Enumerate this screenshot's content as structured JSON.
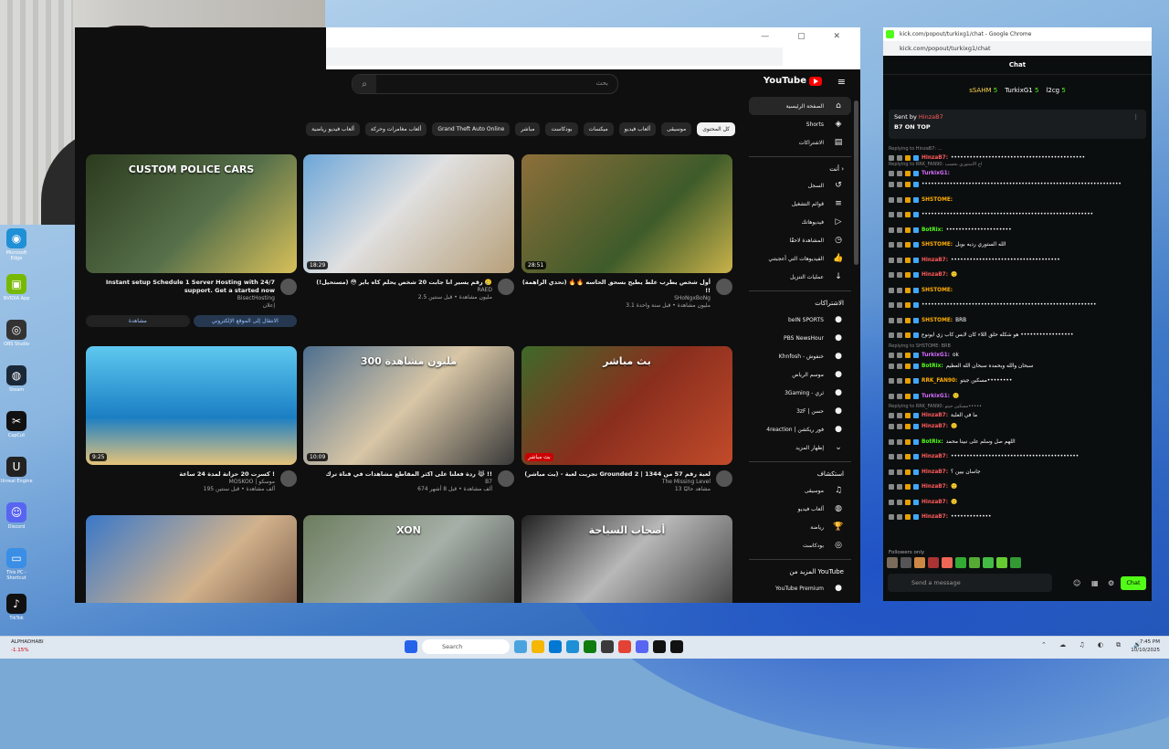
{
  "desktop": {
    "icons": [
      {
        "label": "Microsoft Edge",
        "color": "#1f8fd6",
        "glyph": "◉"
      },
      {
        "label": "NVIDIA App",
        "color": "#76b900",
        "glyph": "▣"
      },
      {
        "label": "OBS Studio",
        "color": "#333333",
        "glyph": "◎"
      },
      {
        "label": "Steam",
        "color": "#1b2838",
        "glyph": "◍"
      },
      {
        "label": "CapCut",
        "color": "#111111",
        "glyph": "✂"
      },
      {
        "label": "Unreal Engine",
        "color": "#222222",
        "glyph": "U"
      },
      {
        "label": "Discord",
        "color": "#5865f2",
        "glyph": "☺"
      },
      {
        "label": "This PC - Shortcut",
        "color": "#3a8ee6",
        "glyph": "▭"
      },
      {
        "label": "TikTok",
        "color": "#111111",
        "glyph": "♪"
      }
    ]
  },
  "youtube": {
    "search_placeholder": "بحث",
    "logo_text": "YouTube",
    "chips": [
      {
        "label": "كل المحتوى",
        "active": true
      },
      {
        "label": "موسيقى"
      },
      {
        "label": "ألعاب فيديو"
      },
      {
        "label": "ميكسات"
      },
      {
        "label": "بودكاست"
      },
      {
        "label": "مباشر"
      },
      {
        "label": "Grand Theft Auto Online"
      },
      {
        "label": "ألعاب مغامرات وحركة"
      },
      {
        "label": "ألعاب فيديو رياضية"
      }
    ],
    "videos": [
      {
        "title": "أول شخص يطرب علط يطيح بسحق الحاسه 🔥🔥 (تحدي الراهمة) !!",
        "channel": "SHoNgxBoNg",
        "meta": "3.1 مليون مشاهدة • قبل سنة واحدة",
        "duration": "28:51",
        "bg": "linear-gradient(135deg,#8d6f3a,#3e5b2a 60%,#c9b24a)"
      },
      {
        "title": "رقم يسير انا جابت 20 شخص يحلم كاه باير 😳 (مستحيل!) 🥲",
        "channel": "RAED",
        "meta": "2.5 مليون مشاهدة • قبل سنتين",
        "duration": "18:29",
        "bg": "linear-gradient(135deg,#6ca6d8,#e0e0e0 45%,#b7a07a)"
      },
      {
        "title": "Instant setup Schedule 1 Server Hosting with 24/7 support. Get a started now",
        "channel": "BisectHosting",
        "meta": "إعلان",
        "duration": "",
        "bg": "linear-gradient(135deg,#2b3b1e,#57704a 55%,#d7c05a)",
        "overlay": "CUSTOM POLICE CARS",
        "ad_buttons": [
          "مشاهدة",
          "الانتقال إلى الموقع الإلكتروني"
        ]
      },
      {
        "title": "(بث مباشر) - تجربت لعبة Grounded 2 | لعبة رقم 57 من 1344",
        "channel": "The Missing Level",
        "meta": "13 مشاهد حاليًا",
        "duration": "بث مباشر",
        "bg": "linear-gradient(135deg,#3e6a2a,#8a2e1e 50%,#c24b2a)",
        "overlay": "بث مباشر"
      },
      {
        "title": "ردة فعلنا على اكثر المقاطع مشاهدات في قناة ترك 😹 !!",
        "channel": "B7",
        "meta": "674 ألف مشاهدة • قبل 8 أشهر",
        "duration": "10:09",
        "bg": "linear-gradient(135deg,#4e6f8f,#d8c6a6 50%,#3a3a3a)",
        "overlay": "300 مليون مشاهدة"
      },
      {
        "title": "كسرت 20 حزانة لمدة 24 ساعة !",
        "channel": "MOSKOO | موسكو",
        "meta": "195 ألف مشاهدة • قبل سنتين",
        "duration": "9:25",
        "bg": "linear-gradient(180deg,#5ec8ef,#1b7fc4 60%,#e6c37a)"
      },
      {
        "title": "",
        "channel": "",
        "meta": "",
        "duration": "",
        "bg": "linear-gradient(135deg,#222,#b8b8b8 45%,#2e2e2e)",
        "overlay": "أصحاب السياحة"
      },
      {
        "title": "",
        "channel": "",
        "meta": "",
        "duration": "",
        "bg": "linear-gradient(135deg,#6c7d5e,#a6b0a8 50%,#3d3d3d)",
        "overlay": "XON"
      },
      {
        "title": "",
        "channel": "",
        "meta": "",
        "duration": "",
        "bg": "linear-gradient(135deg,#3a78c9,#d1b28c 55%,#6b4a3a)"
      }
    ],
    "sidebar": {
      "main": [
        {
          "label": "الصفحة الرئيسية",
          "icon": "⌂",
          "active": true
        },
        {
          "label": "Shorts",
          "icon": "◈"
        },
        {
          "label": "الاشتراكات",
          "icon": "▤"
        }
      ],
      "you_header": "أنت",
      "you": [
        {
          "label": "السجل",
          "icon": "↺"
        },
        {
          "label": "قوائم التشغيل",
          "icon": "≡"
        },
        {
          "label": "فيديوهاتك",
          "icon": "▷"
        },
        {
          "label": "المشاهدة لاحقًا",
          "icon": "◷"
        },
        {
          "label": "الفيديوهات التي أعجبتني",
          "icon": "👍"
        },
        {
          "label": "عمليات التنزيل",
          "icon": "↓"
        }
      ],
      "subs_header": "الاشتراكات",
      "subs": [
        {
          "label": "beIN SPORTS"
        },
        {
          "label": "PBS NewsHour"
        },
        {
          "label": "Khnfosh - خنفوش"
        },
        {
          "label": "موسم الرياض"
        },
        {
          "label": "3Gaming - ثري"
        },
        {
          "label": "3zF | حسن"
        },
        {
          "label": "4reaction | فور ريكشن"
        }
      ],
      "show_more": "إظهار المزيد",
      "explore_header": "استكشاف",
      "explore": [
        {
          "label": "موسيقى",
          "icon": "♫"
        },
        {
          "label": "ألعاب فيديو",
          "icon": "◍"
        },
        {
          "label": "رياضة",
          "icon": "🏆"
        },
        {
          "label": "بودكاست",
          "icon": "◎"
        }
      ],
      "more_header": "المزيد من YouTube",
      "more": [
        {
          "label": "YouTube Premium"
        }
      ]
    }
  },
  "kick": {
    "window_title": "kick.com/popout/turkixg1/chat - Google Chrome",
    "url": "kick.com/popout/turkixg1/chat",
    "header": "Chat",
    "top_gifters": [
      {
        "name": "sSAHM",
        "count": "5"
      },
      {
        "name": "TurkixG1",
        "count": "5"
      },
      {
        "name": "l2cg",
        "count": "5"
      }
    ],
    "pinned": {
      "sent_by": "Sent by",
      "user": "HinzaB7",
      "text": "B7 ON TOP"
    },
    "messages": [
      {
        "reply": "Replying to HinzaB7: ...",
        "user": "HinzaB7:",
        "color": "#ff5b5b",
        "text": "•••••••••••••••••••••••••••••••••••••••••••"
      },
      {
        "reply": "Replying to RRK_FAN90: اح الاستوري بحسب",
        "user": "TurkixG1:",
        "color": "#d66bff",
        "text": ""
      },
      {
        "user": "",
        "color": "#ffffff",
        "text": "••••••••••••••••••••••••••••••••••••••••••••••••••••••••••••••••"
      },
      {
        "user": "SHSTOME:",
        "color": "#ffae00",
        "text": ""
      },
      {
        "user": "",
        "color": "#ffffff",
        "text": "•••••••••••••••••••••••••••••••••••••••••••••••••••••••"
      },
      {
        "user": "BotRix:",
        "color": "#53fc18",
        "text": "•••••••••••••••••••••"
      },
      {
        "user": "SHSTOME:",
        "color": "#ffae00",
        "text": "الله الستوري رديه بوبل"
      },
      {
        "user": "HinzaB7:",
        "color": "#ff5b5b",
        "text": "•••••••••••••••••••••••••••••••••••"
      },
      {
        "user": "HinzaB7:",
        "color": "#ff5b5b",
        "text": "🙂"
      },
      {
        "user": "SHSTOME:",
        "color": "#ffae00",
        "text": ""
      },
      {
        "user": "",
        "color": "#ffffff",
        "text": "••••••••••••••••••••••••••••••••••••••••••••••••••••••••"
      },
      {
        "user": "SHSTOME:",
        "color": "#ffae00",
        "text": "BRB"
      },
      {
        "user": "",
        "color": "#ffffff",
        "text": "هو شكله حلق اللاء كان لابس كاب زي ايونوع •••••••••••••••••"
      },
      {
        "reply": "Replying to SHSTOME: BRB",
        "user": "TurkixG1:",
        "color": "#d66bff",
        "text": "ok"
      },
      {
        "user": "BotRix:",
        "color": "#53fc18",
        "text": "سبحان والله وبحمده سبحان الله العظيم"
      },
      {
        "user": "RRK_FAN90:",
        "color": "#ffae00",
        "text": "مسكين جيتو••••••••"
      },
      {
        "user": "TurkixG1:",
        "color": "#d66bff",
        "text": "🙂"
      },
      {
        "reply": "Replying to RRK_FAN90: مسكين جيتو•••••",
        "user": "HinzaB7:",
        "color": "#ff5b5b",
        "text": "ما في الغلبة"
      },
      {
        "user": "HinzaB7:",
        "color": "#ff5b5b",
        "text": "🙂"
      },
      {
        "user": "BotRix:",
        "color": "#53fc18",
        "text": "اللهم صل وسلم على نبينا محمد"
      },
      {
        "user": "HinzaB7:",
        "color": "#ff5b5b",
        "text": "•••••••••••••••••••••••••••••••••••••••••"
      },
      {
        "user": "HinzaB7:",
        "color": "#ff5b5b",
        "text": "جاسان بيين ؟"
      },
      {
        "user": "HinzaB7:",
        "color": "#ff5b5b",
        "text": "🙂"
      },
      {
        "user": "HinzaB7:",
        "color": "#ff5b5b",
        "text": "🙂"
      },
      {
        "user": "HinzaB7:",
        "color": "#ff5b5b",
        "text": "•••••••••••••"
      }
    ],
    "followers_only": "Followers only",
    "send_placeholder": "Send a message",
    "chat_button": "Chat"
  },
  "taskbar": {
    "weather_name": "ALPHADHABI",
    "weather_value": "-1.15%",
    "search_label": "Search",
    "time": "7:45 PM",
    "date": "10/10/2025"
  }
}
